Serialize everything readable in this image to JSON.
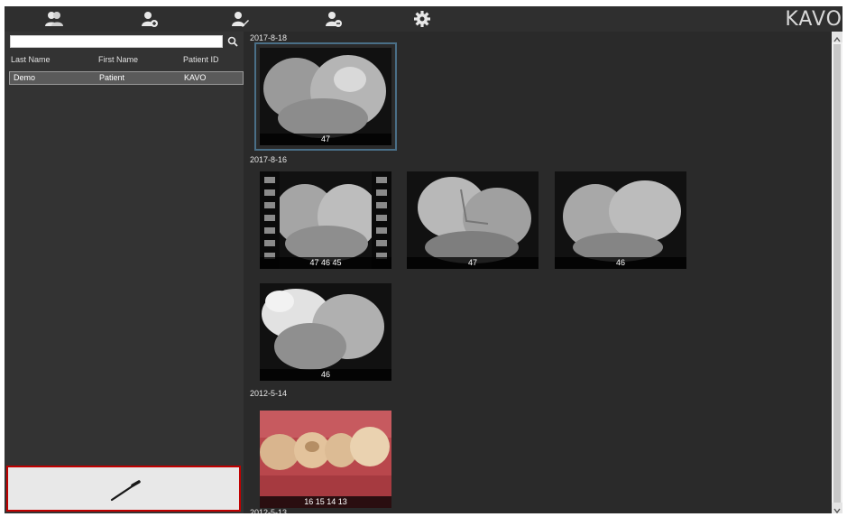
{
  "toolbar": {
    "icons": [
      "patients-icon",
      "add-patient-icon",
      "edit-patient-icon",
      "remove-patient-icon",
      "settings-icon"
    ],
    "brand": "KAVO"
  },
  "patients": {
    "search": {
      "value": "",
      "placeholder": ""
    },
    "columns": [
      "Last Name",
      "First Name",
      "Patient ID"
    ],
    "rows": [
      {
        "last_name": "Demo",
        "first_name": "Patient",
        "patient_id": "KAVO"
      }
    ]
  },
  "gallery": {
    "groups": [
      {
        "date": "2017-8-18",
        "images": [
          {
            "label": "47",
            "kind": "gray",
            "selected": true
          }
        ]
      },
      {
        "date": "2017-8-16",
        "images": [
          {
            "label": "47 46 45",
            "kind": "video"
          },
          {
            "label": "47",
            "kind": "gray"
          },
          {
            "label": "46",
            "kind": "gray"
          },
          {
            "label": "46",
            "kind": "gray"
          }
        ]
      },
      {
        "date": "2012-5-14",
        "images": [
          {
            "label": "16 15 14 13",
            "kind": "color"
          }
        ]
      },
      {
        "date": "2012-5-13",
        "images": []
      }
    ]
  },
  "colors": {
    "background": "#2a2a2a",
    "panel": "#333333",
    "selection": "#4a6f87",
    "highlight_border": "#c00000"
  }
}
